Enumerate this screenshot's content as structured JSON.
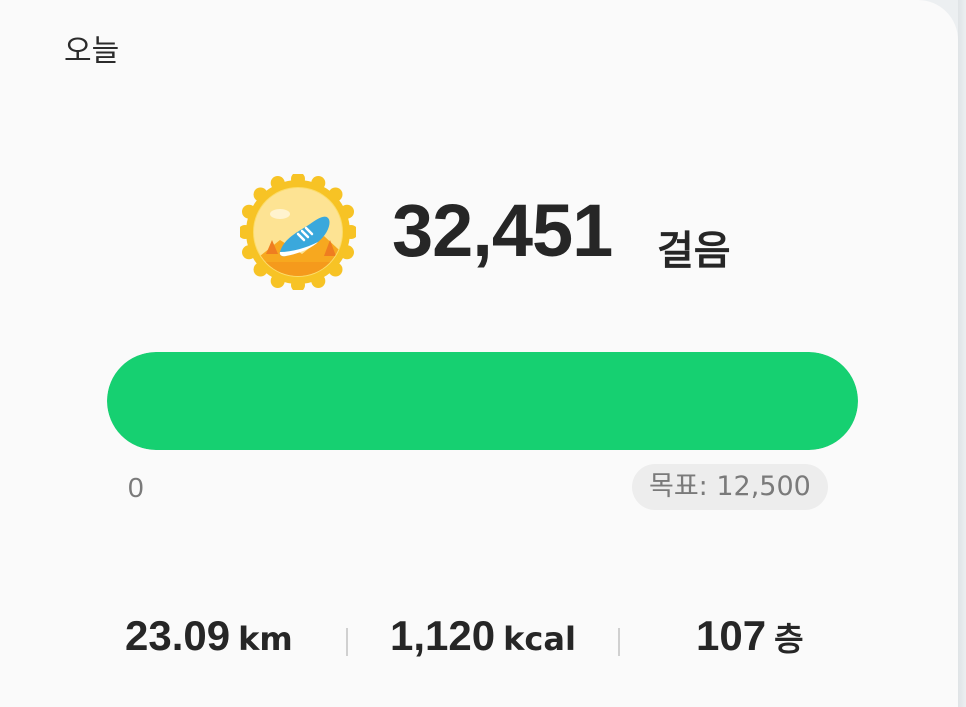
{
  "header": {
    "title": "오늘"
  },
  "badge": {
    "icon": "running-shoe-badge-icon"
  },
  "steps": {
    "count": "32,451",
    "unit": "걸음"
  },
  "progress": {
    "fraction": 1.0,
    "fill_color": "#16d071",
    "start_label": "0",
    "goal_label": "목표: 12,500"
  },
  "stats": {
    "distance": {
      "value": "23.09",
      "unit": "km"
    },
    "calories": {
      "value": "1,120",
      "unit": "kcal"
    },
    "floors": {
      "value": "107",
      "unit": "층"
    }
  }
}
